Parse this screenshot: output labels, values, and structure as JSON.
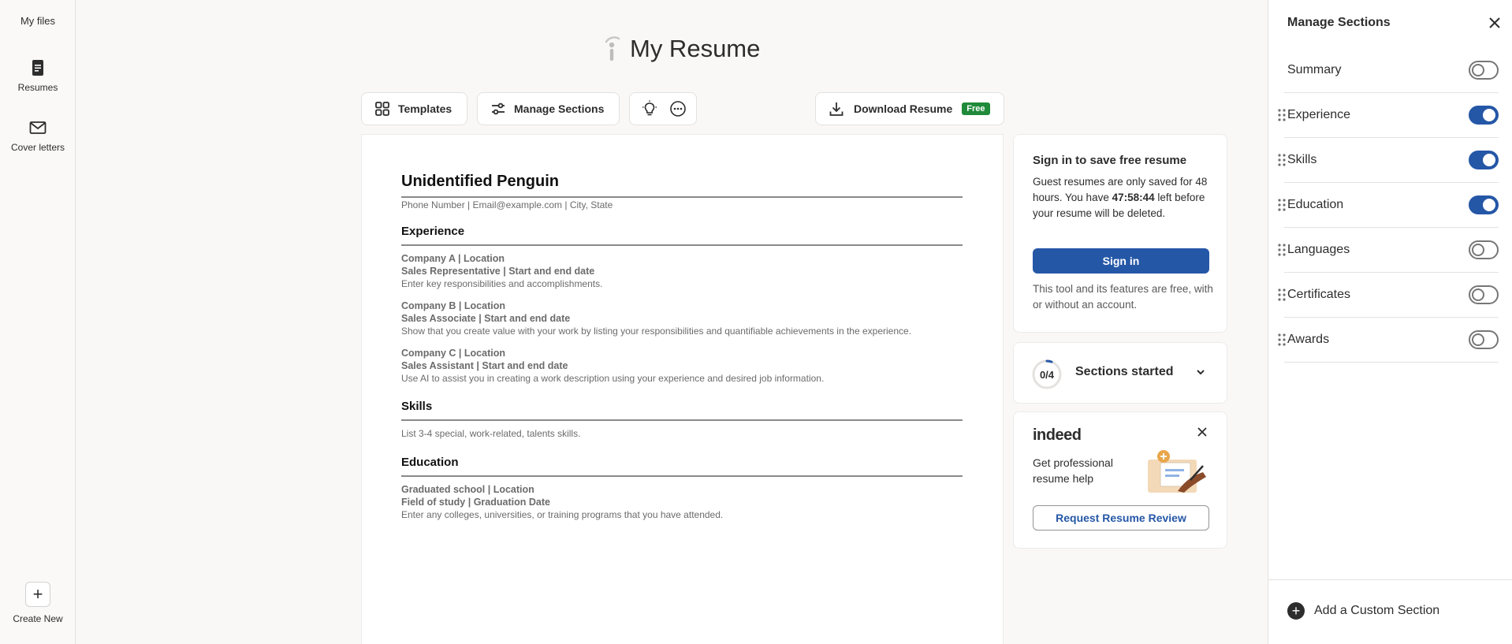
{
  "sidebar": {
    "my_files": "My files",
    "items": [
      {
        "label": "Resumes",
        "icon": "document-icon"
      },
      {
        "label": "Cover letters",
        "icon": "envelope-icon"
      }
    ],
    "create_new": "Create New"
  },
  "header": {
    "title": "My Resume"
  },
  "toolbar": {
    "templates": "Templates",
    "manage_sections": "Manage Sections",
    "download": "Download Resume",
    "free_badge": "Free"
  },
  "resume": {
    "name": "Unidentified Penguin",
    "contact": "Phone Number | Email@example.com | City, State",
    "experience_heading": "Experience",
    "experience": [
      {
        "company": "Company A | Location",
        "role": "Sales Representative | Start and end date",
        "desc": "Enter key responsibilities and accomplishments."
      },
      {
        "company": "Company B | Location",
        "role": "Sales Associate | Start and end date",
        "desc": "Show that you create value with your work by listing your responsibilities and quantifiable achievements in the experience."
      },
      {
        "company": "Company C | Location",
        "role": "Sales Assistant | Start and end date",
        "desc": "Use AI to assist you in creating a work description using your experience and desired job information."
      }
    ],
    "skills_heading": "Skills",
    "skills_text": "List 3-4 special, work-related, talents skills.",
    "education_heading": "Education",
    "education": {
      "school": "Graduated school | Location",
      "field": "Field of study | Graduation Date",
      "desc": "Enter any colleges, universities, or training programs that you have attended."
    }
  },
  "signin_card": {
    "title": "Sign in to save free resume",
    "body_pre": "Guest resumes are only saved for 48 hours. You have ",
    "timer": "47:58:44",
    "body_post": " left before your resume will be deleted.",
    "button": "Sign in",
    "note": "This tool and its features are free, with or without an account."
  },
  "progress_card": {
    "count": "0/4",
    "completed": 0,
    "total": 4,
    "label": "Sections started"
  },
  "promo_card": {
    "logo": "indeed",
    "text": "Get professional resume help",
    "button": "Request Resume Review"
  },
  "manage_panel": {
    "title": "Manage Sections",
    "sections": [
      {
        "label": "Summary",
        "on": false,
        "draggable": false
      },
      {
        "label": "Experience",
        "on": true,
        "draggable": true
      },
      {
        "label": "Skills",
        "on": true,
        "draggable": true
      },
      {
        "label": "Education",
        "on": true,
        "draggable": true
      },
      {
        "label": "Languages",
        "on": false,
        "draggable": true
      },
      {
        "label": "Certificates",
        "on": false,
        "draggable": true
      },
      {
        "label": "Awards",
        "on": false,
        "draggable": true
      }
    ],
    "add_custom": "Add a Custom Section"
  },
  "colors": {
    "accent_blue": "#2557a7",
    "free_green": "#1f8a3a"
  }
}
